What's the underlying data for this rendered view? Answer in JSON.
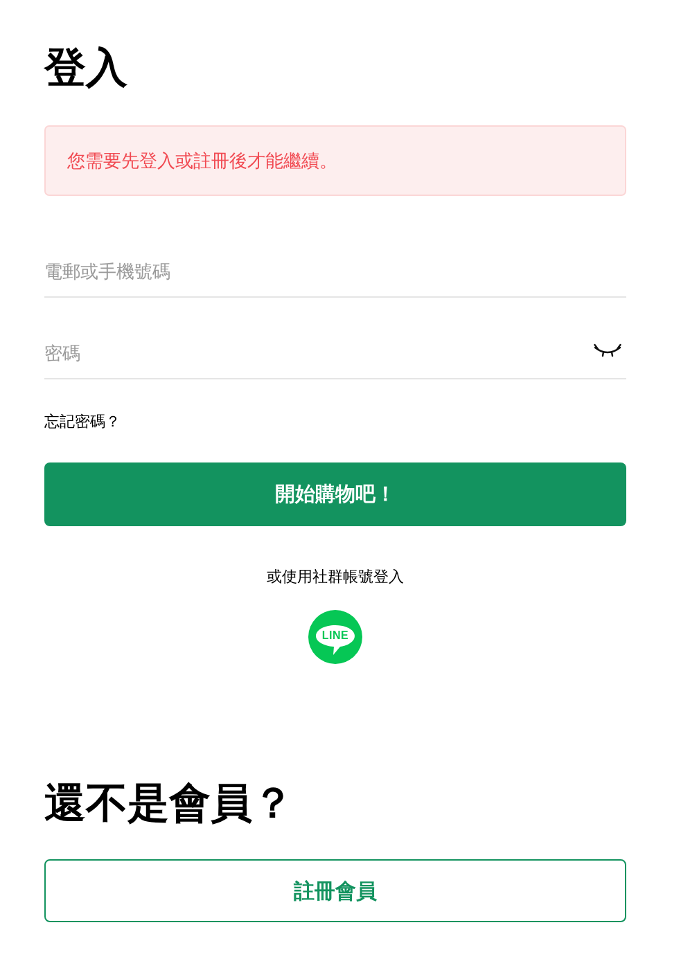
{
  "page": {
    "title": "登入"
  },
  "alert": {
    "message": "您需要先登入或註冊後才能繼續。"
  },
  "fields": [
    {
      "kind": "text",
      "placeholder": "電郵或手機號碼"
    },
    {
      "kind": "password",
      "placeholder": "密碼",
      "revealed": false
    }
  ],
  "forgot_password_link": "忘記密碼？",
  "submit_button": "開始購物吧！",
  "social_login": {
    "label": "或使用社群帳號登入",
    "providers": [
      {
        "kind": "line",
        "label": "LINE"
      }
    ]
  },
  "register": {
    "heading": "還不是會員？",
    "button": "註冊會員"
  }
}
